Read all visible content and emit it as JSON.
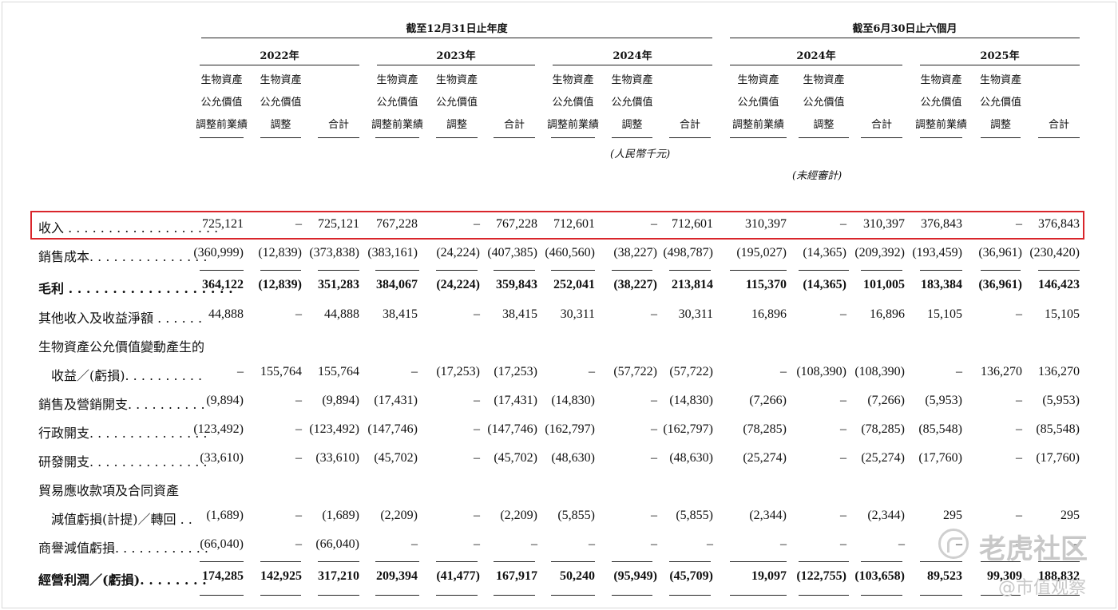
{
  "headers": {
    "year_end_group": "截至12月31日止年度",
    "six_month_group": "截至6月30日止六個月",
    "periods": [
      "2022年",
      "2023年",
      "2024年",
      "2024年",
      "2025年"
    ],
    "col_pre_lines": [
      "生物資產",
      "公允價值",
      "調整前業績"
    ],
    "col_adj_lines": [
      "生物資產",
      "公允價值",
      "調整"
    ],
    "col_total": "合計",
    "currency_note": "(人民幣千元)",
    "unaudited_note": "(未經審計)"
  },
  "rows": [
    {
      "label": "收入 . . . . . . . . . . . . . . . . . . .",
      "bold": false,
      "values": [
        "725,121",
        "–",
        "725,121",
        "767,228",
        "–",
        "767,228",
        "712,601",
        "–",
        "712,601",
        "310,397",
        "–",
        "310,397",
        "376,843",
        "–",
        "376,843"
      ]
    },
    {
      "label": "銷售成本. . . . . . . . . . . . . . .",
      "bold": false,
      "values": [
        "(360,999)",
        "(12,839)",
        "(373,838)",
        "(383,161)",
        "(24,224)",
        "(407,385)",
        "(460,560)",
        "(38,227)",
        "(498,787)",
        "(195,027)",
        "(14,365)",
        "(209,392)",
        "(193,459)",
        "(36,961)",
        "(230,420)"
      ]
    },
    {
      "label": "毛利 . . . . . . . . . . . . . . . . . . .",
      "bold": true,
      "values": [
        "364,122",
        "(12,839)",
        "351,283",
        "384,067",
        "(24,224)",
        "359,843",
        "252,041",
        "(38,227)",
        "213,814",
        "115,370",
        "(14,365)",
        "101,005",
        "183,384",
        "(36,961)",
        "146,423"
      ]
    },
    {
      "label": "其他收入及收益淨額 . . . . . .",
      "bold": false,
      "values": [
        "44,888",
        "–",
        "44,888",
        "38,415",
        "–",
        "38,415",
        "30,311",
        "–",
        "30,311",
        "16,896",
        "–",
        "16,896",
        "15,105",
        "–",
        "15,105"
      ]
    },
    {
      "label": "生物資產公允價值變動產生的",
      "bold": false,
      "values": []
    },
    {
      "label": "收益／(虧損). . . . . . . . . .",
      "bold": false,
      "indent": true,
      "values": [
        "–",
        "155,764",
        "155,764",
        "–",
        "(17,253)",
        "(17,253)",
        "–",
        "(57,722)",
        "(57,722)",
        "–",
        "(108,390)",
        "(108,390)",
        "–",
        "136,270",
        "136,270"
      ]
    },
    {
      "label": "銷售及營銷開支. . . . . . . . . .",
      "bold": false,
      "values": [
        "(9,894)",
        "–",
        "(9,894)",
        "(17,431)",
        "–",
        "(17,431)",
        "(14,830)",
        "–",
        "(14,830)",
        "(7,266)",
        "–",
        "(7,266)",
        "(5,953)",
        "–",
        "(5,953)"
      ]
    },
    {
      "label": "行政開支. . . . . . . . . . . . . . .",
      "bold": false,
      "values": [
        "(123,492)",
        "–",
        "(123,492)",
        "(147,746)",
        "–",
        "(147,746)",
        "(162,797)",
        "–",
        "(162,797)",
        "(78,285)",
        "–",
        "(78,285)",
        "(85,548)",
        "–",
        "(85,548)"
      ]
    },
    {
      "label": "研發開支. . . . . . . . . . . . . . .",
      "bold": false,
      "values": [
        "(33,610)",
        "–",
        "(33,610)",
        "(45,702)",
        "–",
        "(45,702)",
        "(48,630)",
        "–",
        "(48,630)",
        "(25,274)",
        "–",
        "(25,274)",
        "(17,760)",
        "–",
        "(17,760)"
      ]
    },
    {
      "label": "貿易應收款項及合同資產",
      "bold": false,
      "values": []
    },
    {
      "label": "減值虧損(計提)／轉回 . .",
      "bold": false,
      "indent": true,
      "values": [
        "(1,689)",
        "–",
        "(1,689)",
        "(2,209)",
        "–",
        "(2,209)",
        "(5,855)",
        "–",
        "(5,855)",
        "(2,344)",
        "–",
        "(2,344)",
        "295",
        "–",
        "295"
      ]
    },
    {
      "label": "商譽減值虧損. . . . . . . . . . . .",
      "bold": false,
      "values": [
        "(66,040)",
        "–",
        "(66,040)",
        "–",
        "–",
        "–",
        "–",
        "–",
        "–",
        "–",
        "–",
        "–",
        "–",
        "–",
        "–"
      ]
    },
    {
      "label": "經營利潤／(虧損). . . . . . . .",
      "bold": true,
      "values": [
        "174,285",
        "142,925",
        "317,210",
        "209,394",
        "(41,477)",
        "167,917",
        "50,240",
        "(95,949)",
        "(45,709)",
        "19,097",
        "(122,755)",
        "(103,658)",
        "89,523",
        "99,309",
        "188,832"
      ]
    }
  ],
  "watermark": {
    "brand": "老虎社区",
    "account": "@市值观察"
  }
}
